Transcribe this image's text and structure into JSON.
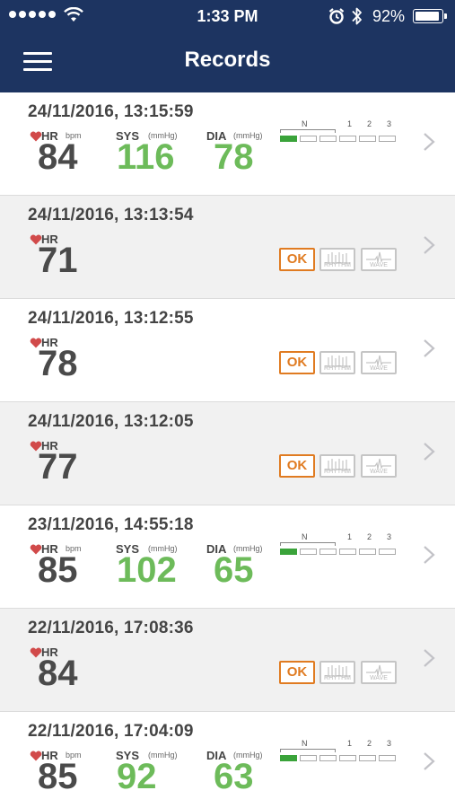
{
  "status_bar": {
    "time": "1:33 PM",
    "battery": "92%"
  },
  "nav": {
    "title": "Records"
  },
  "labels": {
    "hr": "HR",
    "bpm": "bpm",
    "sys": "SYS",
    "dia": "DIA",
    "mmhg": "(mmHg)",
    "ok": "OK",
    "rhythm": "RHYTHM",
    "wave": "WAVE",
    "scale_n": "N",
    "scale_1": "1",
    "scale_2": "2",
    "scale_3": "3"
  },
  "records": [
    {
      "datetime": "24/11/2016, 13:15:59",
      "hr": "84",
      "sys": "116",
      "dia": "78",
      "type": "bp",
      "bp_level_segments_on": 1
    },
    {
      "datetime": "24/11/2016, 13:13:54",
      "hr": "71",
      "type": "ecg"
    },
    {
      "datetime": "24/11/2016, 13:12:55",
      "hr": "78",
      "type": "ecg"
    },
    {
      "datetime": "24/11/2016, 13:12:05",
      "hr": "77",
      "type": "ecg"
    },
    {
      "datetime": "23/11/2016, 14:55:18",
      "hr": "85",
      "sys": "102",
      "dia": "65",
      "type": "bp",
      "bp_level_segments_on": 1
    },
    {
      "datetime": "22/11/2016, 17:08:36",
      "hr": "84",
      "type": "ecg"
    },
    {
      "datetime": "22/11/2016, 17:04:09",
      "hr": "85",
      "sys": "92",
      "dia": "63",
      "type": "bp",
      "bp_level_segments_on": 1
    }
  ],
  "colors": {
    "header": "#1d3461",
    "sys_dia": "#6dbb5a",
    "ok": "#e07b21",
    "heart": "#d14a4a",
    "scale_on": "#3aa33a"
  },
  "icons": {
    "menu": "hamburger-icon",
    "wifi": "wifi-icon",
    "alarm": "alarm-icon",
    "bluetooth": "bluetooth-icon",
    "chevron": "chevron-right-icon",
    "heart": "heart-icon"
  }
}
